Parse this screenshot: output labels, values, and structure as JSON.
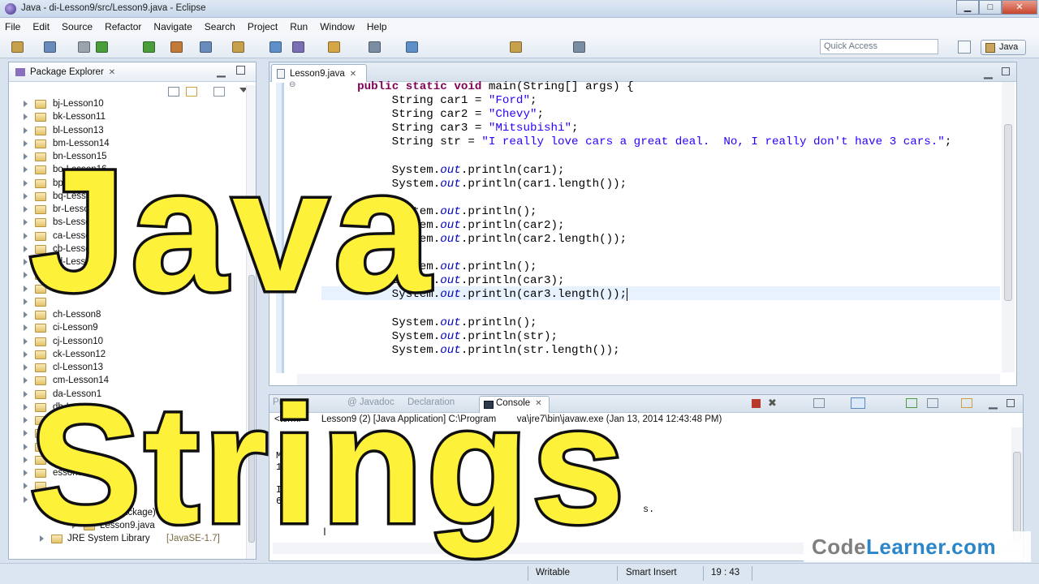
{
  "window": {
    "title": "Java - di-Lesson9/src/Lesson9.java - Eclipse",
    "minimize": "▁",
    "maximize": "□",
    "close": "✕"
  },
  "menu": [
    "File",
    "Edit",
    "Source",
    "Refactor",
    "Navigate",
    "Search",
    "Project",
    "Run",
    "Window",
    "Help"
  ],
  "toolbar": {
    "quick_access_placeholder": "Quick Access",
    "perspective": "Java",
    "icon_colors": [
      "#c6a04a",
      "#6a8bbd",
      "#9aa4af",
      "#4a9d3b",
      "#4a9d3b",
      "#c27a3a",
      "#6a8bbd",
      "#c6a04a",
      "#5f8fc9",
      "#7a6fb2",
      "#d6a545",
      "#7b8da3",
      "#5f8fc9",
      "#c6a04a",
      "#7b8da3"
    ]
  },
  "package_explorer": {
    "title": "Package Explorer",
    "items": [
      "bj-Lesson10",
      "bk-Lesson11",
      "bl-Lesson13",
      "bm-Lesson14",
      "bn-Lesson15",
      "bo-Lesson16",
      "bp-Lesson17",
      "bq-Lesson",
      "br-Lesson",
      "bs-Lesson",
      "ca-Lesson",
      "cb-Lesson",
      "cd-Lesson",
      "",
      "",
      "",
      "ch-Lesson8",
      "ci-Lesson9",
      "cj-Lesson10",
      "ck-Lesson12",
      "cl-Lesson13",
      "cm-Lesson14",
      "da-Lesson1",
      "db-L",
      "",
      "",
      "",
      "dg",
      "esson5",
      "",
      ""
    ],
    "default_package": "(default package)",
    "file": "Lesson9.java",
    "jre": "JRE System Library",
    "jre_version": "[JavaSE-1.7]"
  },
  "editor": {
    "tab": "Lesson9.java",
    "code": {
      "main": "main(String[] args) {",
      "car1_value": "\"Ford\"",
      "car2_value": "\"Chevy\"",
      "car3_value": "\"Mitsubishi\"",
      "str_value": "\"I really love cars a great deal.  No, I really don't have 3 cars.\""
    }
  },
  "console": {
    "tabs": {
      "problems": "Pro",
      "javadoc": "Javadoc",
      "declaration": "Declaration",
      "console": "Console"
    },
    "header": "<termi        Lesson9 (2) [Java Application] C:\\Program        va\\jre7\\bin\\javaw.exe (Jan 13, 2014 12:43:48 PM)",
    "output": [
      {
        "text": ""
      },
      {
        "text": ""
      },
      {
        "text": "Mitsu"
      },
      {
        "text": "10"
      },
      {
        "text": ""
      },
      {
        "text": "I rea"
      },
      {
        "text": "65"
      }
    ],
    "tail_text": "s."
  },
  "status": {
    "mode": "Writable",
    "insert": "Smart Insert",
    "position": "19 : 43"
  },
  "brand": {
    "left": "Code",
    "right": "Learner.com"
  },
  "overlay": {
    "line1": "Java",
    "line2": "Strings"
  }
}
